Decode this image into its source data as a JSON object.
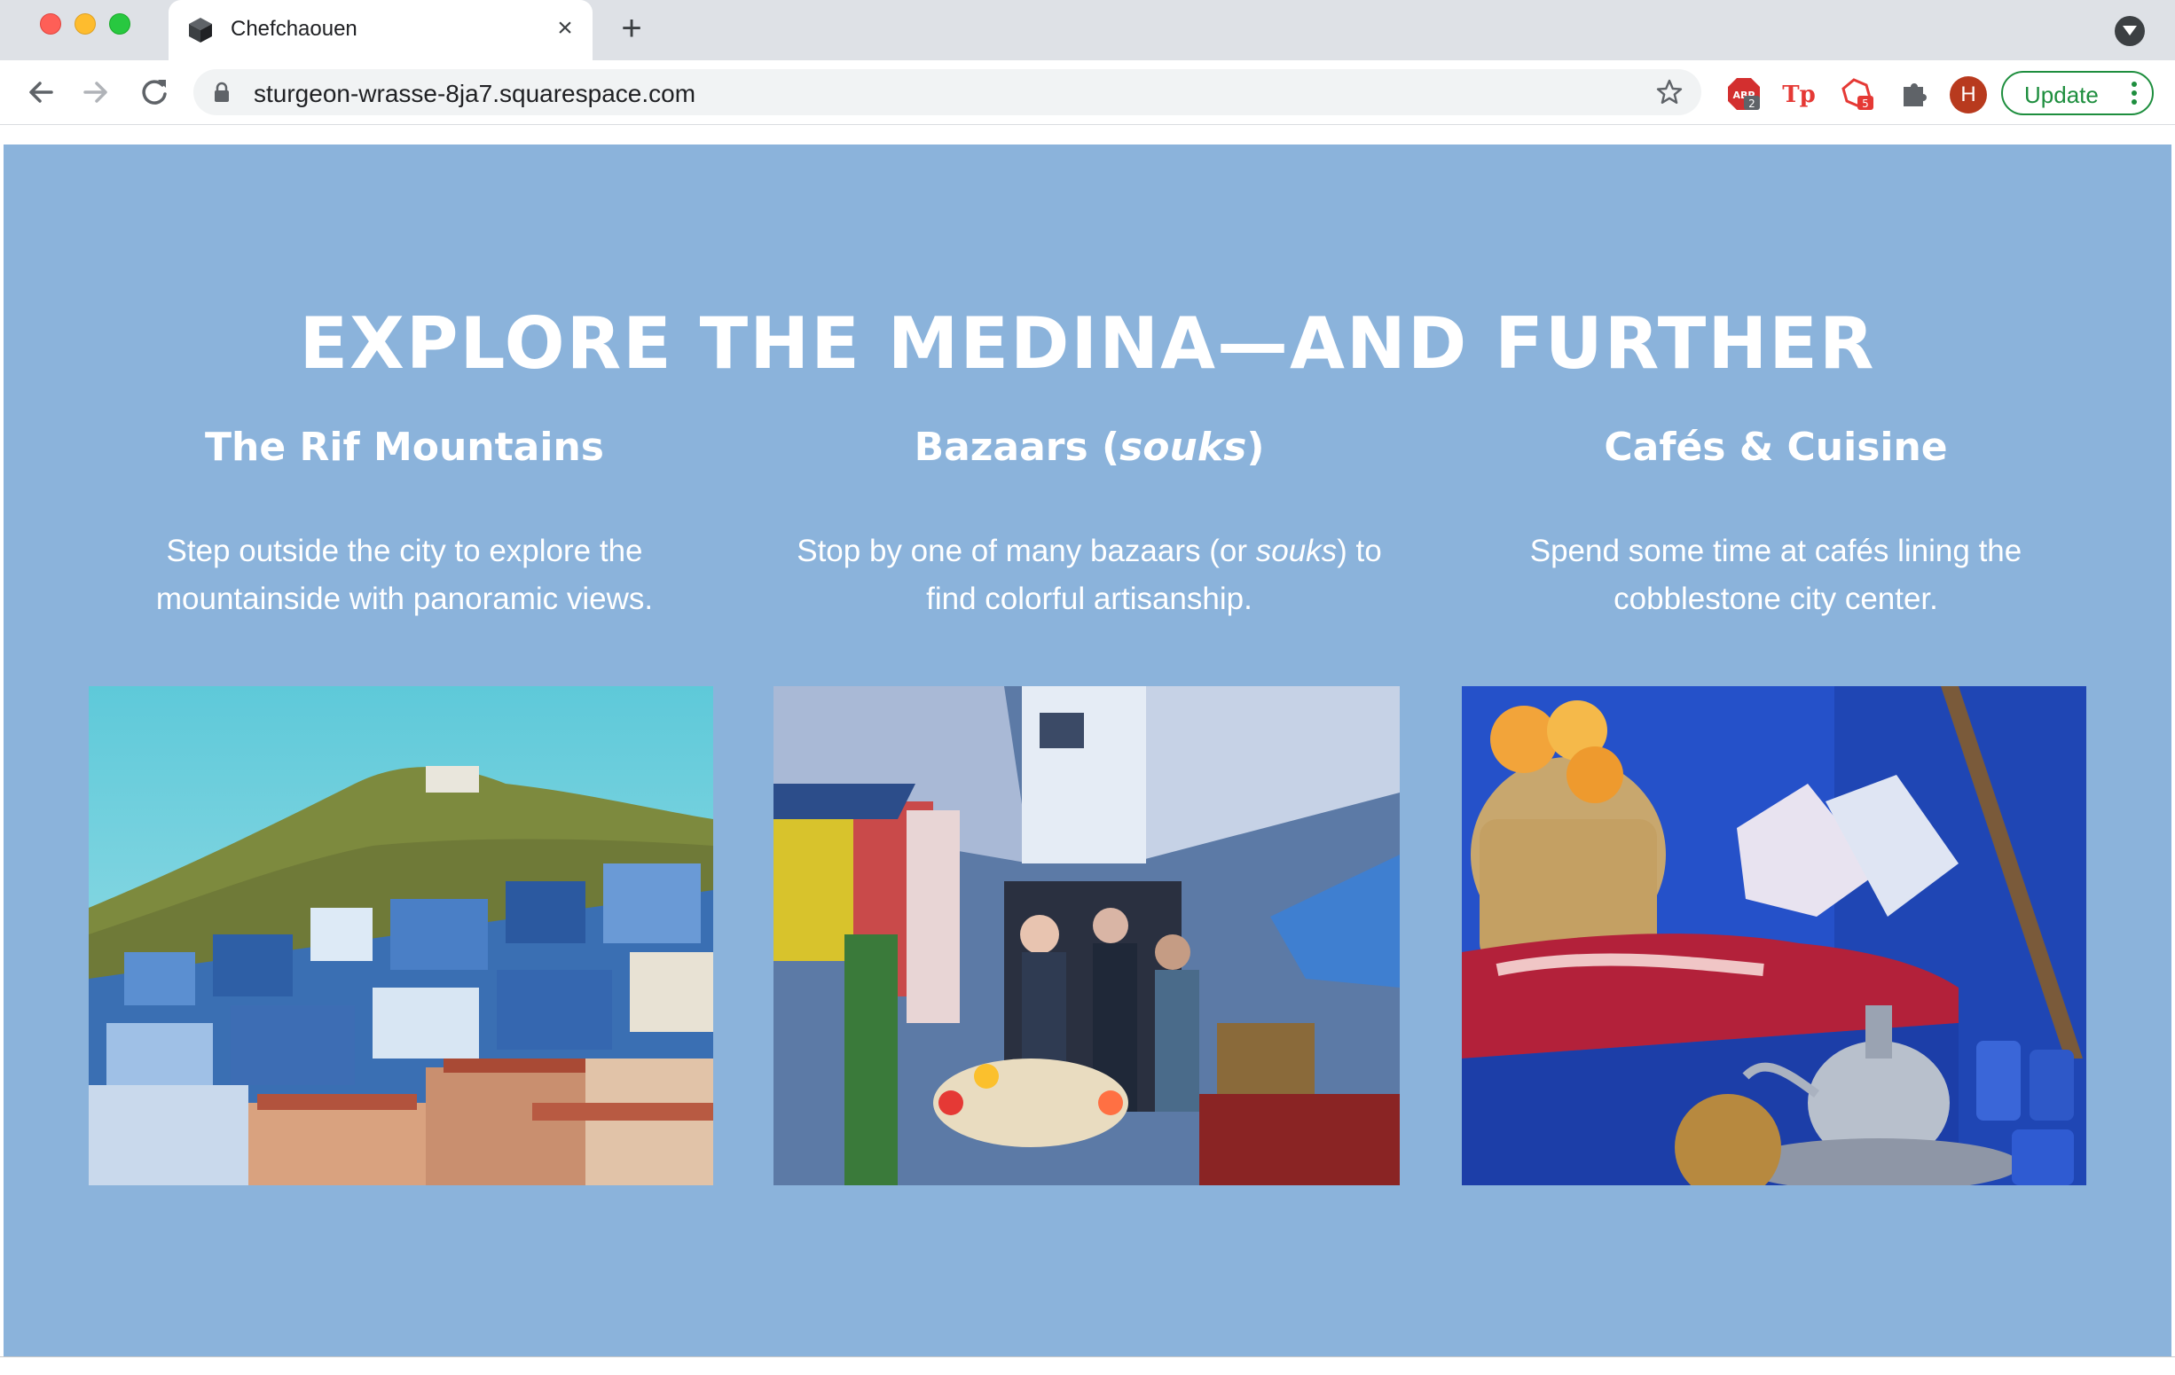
{
  "browser": {
    "tab_title": "Chefchaouen",
    "url": "sturgeon-wrasse-8ja7.squarespace.com",
    "new_tab_symbol": "+",
    "close_symbol": "×",
    "avatar_letter": "H",
    "update_label": "Update",
    "extensions": [
      {
        "name": "adblock-extension",
        "label": "ABP",
        "badge": "2",
        "color": "#d32f2f"
      },
      {
        "name": "tp-extension",
        "label": "Tp",
        "color": "#e53935"
      },
      {
        "name": "shield-extension",
        "badge": "5",
        "color": "#e53935"
      },
      {
        "name": "puzzle-extension",
        "color": "#5f6368"
      }
    ],
    "accent_color": "#1e8e3e"
  },
  "section": {
    "background": "#8bb3db",
    "heading": "EXPLORE THE MEDINA—AND FURTHER",
    "columns": [
      {
        "title": "The Rif Mountains",
        "description": "Step outside the city to explore the mountainside with panoramic views.",
        "image": "chefchaouen-hillside-photo"
      },
      {
        "title_before": "Bazaars (",
        "title_italic": "souks",
        "title_after": ")",
        "description_before": "Stop by one of many bazaars (or ",
        "description_italic": "souks",
        "description_after": ") to find colorful artisanship.",
        "image": "bazaar-market-photo"
      },
      {
        "title": "Cafés & Cuisine",
        "description": "Spend some time at cafés lining the cobblestone city center.",
        "image": "cafe-teapot-photo"
      }
    ]
  }
}
